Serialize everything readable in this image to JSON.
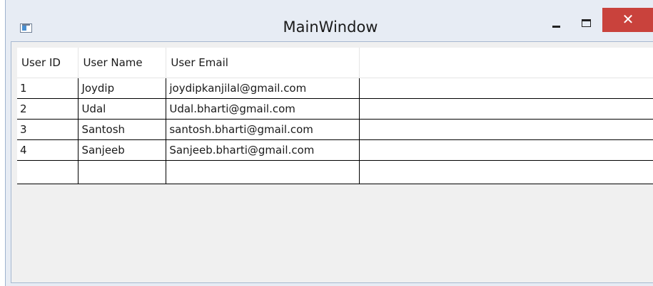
{
  "window": {
    "title": "MainWindow",
    "close_glyph": "✕",
    "icons": {
      "app": "window-app-icon",
      "minimize": "minimize-icon",
      "maximize": "maximize-icon",
      "close": "close-icon"
    }
  },
  "grid": {
    "columns": [
      "User ID",
      "User Name",
      "User Email",
      ""
    ],
    "rows": [
      {
        "id": "1",
        "name": "Joydip",
        "email": "joydipkanjilal@gmail.com"
      },
      {
        "id": "2",
        "name": "Udal",
        "email": "Udal.bharti@gmail.com"
      },
      {
        "id": "3",
        "name": "Santosh",
        "email": "santosh.bharti@gmail.com"
      },
      {
        "id": "4",
        "name": "Sanjeeb",
        "email": "Sanjeeb.bharti@gmail.com"
      }
    ]
  }
}
